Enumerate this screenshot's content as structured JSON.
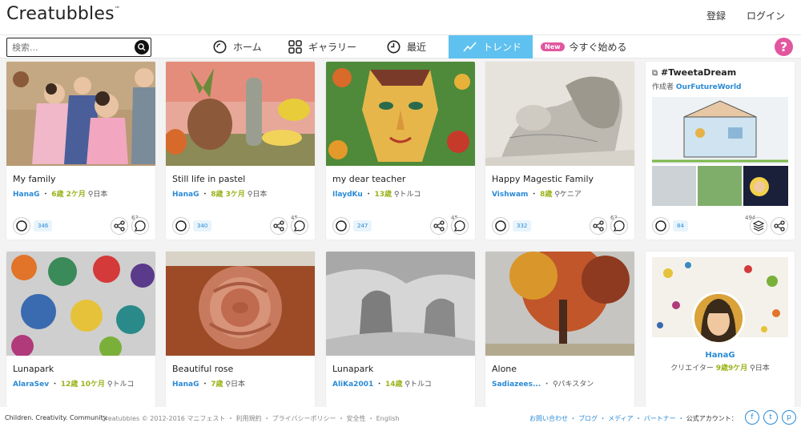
{
  "header": {
    "logo": "Creatubbles",
    "logo_tm": "™",
    "register": "登録",
    "login": "ログイン"
  },
  "nav": {
    "search_placeholder": "検索...",
    "home": "ホーム",
    "gallery": "ギャラリー",
    "recent": "最近",
    "trend": "トレンド",
    "new_badge": "New",
    "start_now": "今すぐ始める",
    "help": "?"
  },
  "cards_row1": [
    {
      "title": "My family",
      "user": "HanaG",
      "age": "6歳 2ケ月",
      "loc": "日本",
      "bubbles": "346",
      "comments": "63"
    },
    {
      "title": "Still life in pastel",
      "user": "HanaG",
      "age": "8歳 3ケ月",
      "loc": "日本",
      "bubbles": "340",
      "comments": "45"
    },
    {
      "title": "my dear teacher",
      "user": "IlaydKu",
      "age": "13歳",
      "loc": "トルコ",
      "bubbles": "247",
      "comments": "45"
    },
    {
      "title": "Happy Magestic Family",
      "user": "Vishwam",
      "age": "8歳",
      "loc": "ケニア",
      "bubbles": "332",
      "comments": "63"
    }
  ],
  "gallery_card": {
    "title": "#TweetaDream",
    "author_label": "作成者",
    "author": "OurFutureWorld",
    "bubbles": "84",
    "items": "494"
  },
  "cards_row2": [
    {
      "title": "Lunapark",
      "user": "AlaraSev",
      "age": "12歳 10ケ月",
      "loc": "トルコ"
    },
    {
      "title": "Beautiful rose",
      "user": "HanaG",
      "age": "7歳",
      "loc": "日本"
    },
    {
      "title": "Lunapark",
      "user": "AliKa2001",
      "age": "14歳",
      "loc": "トルコ"
    },
    {
      "title": "Alone",
      "user": "Sadiazees...",
      "age": "",
      "loc": "パキスタン"
    }
  ],
  "creator_card": {
    "name": "HanaG",
    "role": "クリエイター",
    "age": "9歳9ケ月",
    "loc": "日本"
  },
  "footer": {
    "tagline": "Children. Creativity. Community.",
    "copyright": "Creatubbles © 2012-2016",
    "links": "マニフェスト ・ 利用規約 ・ プライバシーポリシー ・ 安全性 ・ English",
    "contact": "お問い合わせ ・ ブログ ・ メディア ・ パートナー ・",
    "official": "公式アカウント：",
    "social": [
      "f",
      "t",
      "p"
    ]
  },
  "colors": {
    "accent_blue": "#5fc1ef",
    "user_blue": "#2a8ad6",
    "age_green": "#9bb31c",
    "pink": "#e2569f"
  }
}
